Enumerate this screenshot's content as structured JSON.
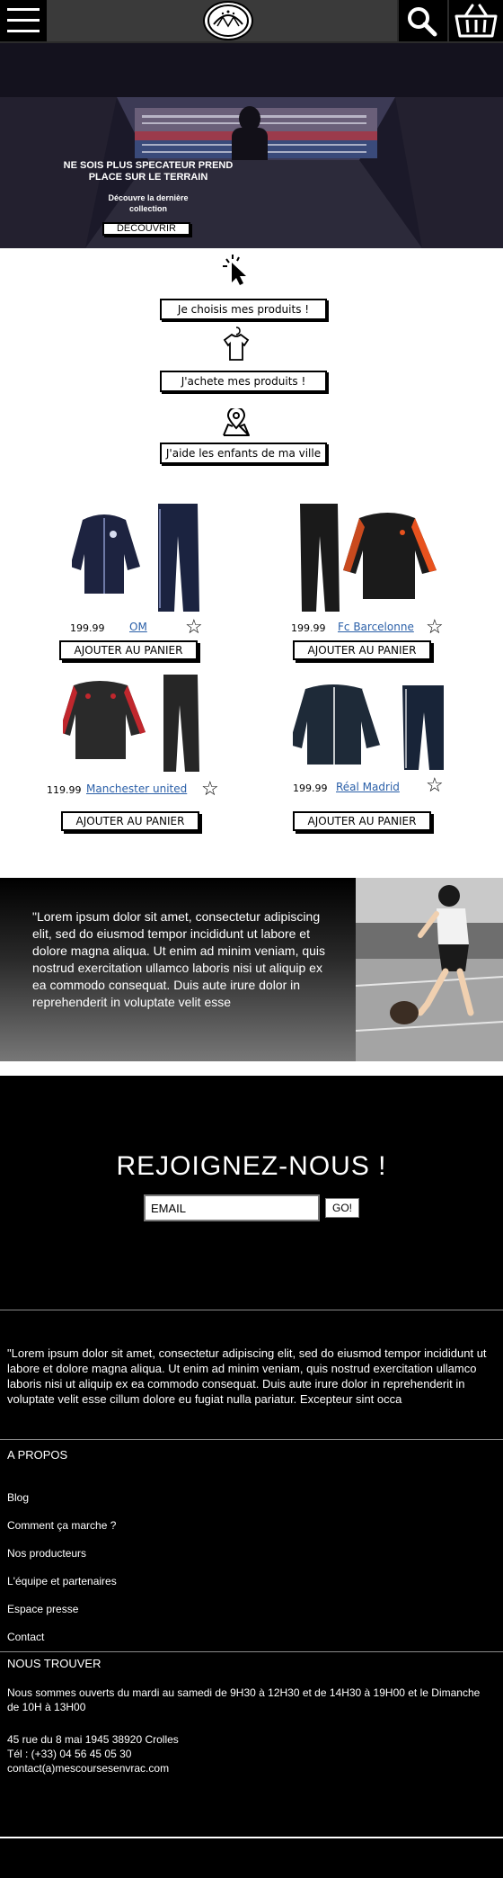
{
  "hero": {
    "title": "NE SOIS PLUS SPECATEUR PREND PLACE SUR LE TERRAIN",
    "subtitle": "Découvre la dernière collection",
    "button": "DECOUVRIR"
  },
  "steps": [
    {
      "icon": "cursor-click-icon",
      "label": "Je choisis mes produits !"
    },
    {
      "icon": "hanger-shirt-icon",
      "label": "J'achete mes produits !"
    },
    {
      "icon": "map-pin-icon",
      "label": "J'aide les enfants de ma ville"
    }
  ],
  "products": [
    {
      "price": "199.99",
      "name": "OM",
      "button": "AJOUTER AU PANIER",
      "jacket_color": "#1d2340",
      "pants_color": "#1b2340",
      "accent": "#8a96c8"
    },
    {
      "price": "199.99",
      "name": "Fc Barcelonne",
      "button": "AJOUTER AU PANIER",
      "jacket_color": "#1b1b1b",
      "pants_color": "#1a1a1a",
      "accent": "#e8521e"
    },
    {
      "price": "119.99",
      "name": "Manchester united",
      "button": "AJOUTER AU PANIER",
      "jacket_color": "#2a2a2a",
      "pants_color": "#262626",
      "accent": "#c0272d"
    },
    {
      "price": "199.99",
      "name": "Réal Madrid",
      "button": "AJOUTER AU PANIER",
      "jacket_color": "#1e2a38",
      "pants_color": "#182438",
      "accent": "#ffffff"
    }
  ],
  "quote": {
    "text": "\"Lorem ipsum dolor sit amet, consectetur adipiscing elit, sed do eiusmod tempor incididunt ut labore et dolore magna aliqua. Ut enim ad minim veniam, quis nostrud exercitation ullamco laboris nisi ut aliquip ex ea commodo consequat. Duis aute irure dolor in reprehenderit in voluptate velit esse"
  },
  "newsletter": {
    "title": "REJOIGNEZ-NOUS !",
    "email_value": "EMAIL",
    "button": "GO!"
  },
  "footer": {
    "quote": "\"Lorem ipsum dolor sit amet, consectetur adipiscing elit, sed do eiusmod tempor incididunt ut labore et dolore magna aliqua. Ut enim ad minim veniam, quis nostrud exercitation ullamco laboris nisi ut aliquip ex ea commodo consequat. Duis aute irure dolor in reprehenderit in voluptate velit esse cillum dolore eu fugiat nulla pariatur. Excepteur sint occa",
    "about_title": "A PROPOS",
    "links": [
      "Blog",
      "Comment ça marche ?",
      "Nos producteurs",
      "L'équipe et partenaires",
      "Espace presse",
      "Contact"
    ],
    "find_title": "NOUS TROUVER",
    "hours": "Nous sommes ouverts du mardi au samedi de 9H30 à 12H30 et de 14H30 à 19H00 et le Dimanche de 10H à 13H00",
    "address": "45 rue du 8 mai 1945 38920 Crolles",
    "phone": " Tél : (+33) 04 56 45 05 30",
    "email": "contact(a)mescoursesenvrac.com"
  }
}
